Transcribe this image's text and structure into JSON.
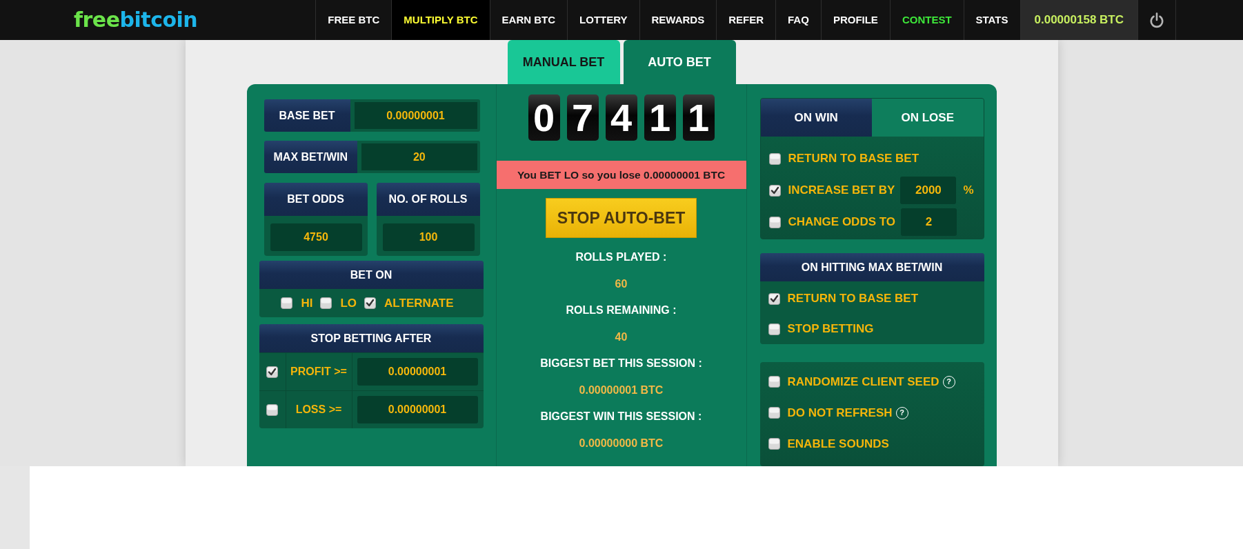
{
  "brand": {
    "parts": [
      {
        "text": "free",
        "color": "#6be34a"
      },
      {
        "text": "bitcoin",
        "color": "#1db5ea"
      }
    ]
  },
  "nav": {
    "items": [
      {
        "label": "FREE BTC",
        "selected": false
      },
      {
        "label": "MULTIPLY BTC",
        "selected": true
      },
      {
        "label": "EARN BTC",
        "selected": false
      },
      {
        "label": "LOTTERY",
        "selected": false
      },
      {
        "label": "REWARDS",
        "selected": false
      },
      {
        "label": "REFER",
        "selected": false
      },
      {
        "label": "FAQ",
        "selected": false
      },
      {
        "label": "PROFILE",
        "selected": false
      },
      {
        "label": "CONTEST",
        "selected": false,
        "color": "#3ee83a"
      },
      {
        "label": "STATS",
        "selected": false
      }
    ],
    "balance": "0.00000158 BTC"
  },
  "bet_tabs": [
    {
      "label": "MANUAL BET",
      "selected": false
    },
    {
      "label": "AUTO BET",
      "selected": true
    }
  ],
  "left": {
    "base_bet": {
      "label": "BASE BET",
      "value": "0.00000001"
    },
    "max_bet_win": {
      "label": "MAX BET/WIN",
      "value": "20"
    },
    "bet_odds": {
      "label": "BET ODDS",
      "value": "4750"
    },
    "rolls": {
      "label": "NO. OF ROLLS",
      "value": "100"
    },
    "bet_on": {
      "title": "BET ON",
      "options": [
        {
          "label": "HI",
          "checked": false
        },
        {
          "label": "LO",
          "checked": false
        },
        {
          "label": "ALTERNATE",
          "checked": true
        }
      ]
    },
    "stop_after": {
      "title": "STOP BETTING AFTER",
      "rows": [
        {
          "label": "PROFIT >=",
          "checked": true,
          "value": "0.00000001"
        },
        {
          "label": "LOSS >=",
          "checked": false,
          "value": "0.00000001"
        }
      ]
    }
  },
  "center": {
    "roll_digits": [
      "0",
      "7",
      "4",
      "1",
      "1"
    ],
    "result": "You BET LO so you lose 0.00000001 BTC",
    "stop_button": "STOP AUTO-BET",
    "stats": [
      {
        "label": "ROLLS PLAYED :",
        "value": "60"
      },
      {
        "label": "ROLLS REMAINING :",
        "value": "40"
      },
      {
        "label": "BIGGEST BET THIS SESSION :",
        "value": "0.00000001 BTC"
      },
      {
        "label": "BIGGEST WIN THIS SESSION :",
        "value": "0.00000000 BTC"
      }
    ]
  },
  "right": {
    "outcome_tabs": [
      {
        "label": "ON WIN",
        "selected": true
      },
      {
        "label": "ON LOSE",
        "selected": false
      }
    ],
    "outcome_options": [
      {
        "kind": "check",
        "label": "RETURN TO BASE BET",
        "checked": false
      },
      {
        "kind": "input",
        "label": "INCREASE BET BY",
        "checked": true,
        "value": "2000",
        "suffix": "%"
      },
      {
        "kind": "input",
        "label": "CHANGE ODDS TO",
        "checked": false,
        "value": "2"
      }
    ],
    "max_hit": {
      "title": "ON HITTING MAX BET/WIN",
      "options": [
        {
          "label": "RETURN TO BASE BET",
          "checked": true
        },
        {
          "label": "STOP BETTING",
          "checked": false
        }
      ]
    },
    "extras": [
      {
        "label": "RANDOMIZE CLIENT SEED",
        "checked": false,
        "help": "?"
      },
      {
        "label": "DO NOT REFRESH",
        "checked": false,
        "help": "?"
      },
      {
        "label": "ENABLE SOUNDS",
        "checked": false
      }
    ]
  }
}
